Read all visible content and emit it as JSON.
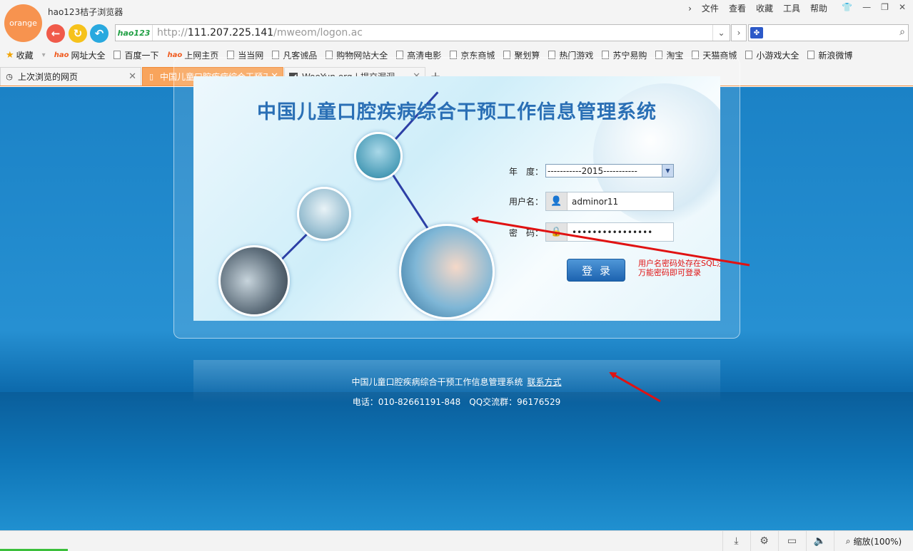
{
  "browser": {
    "logo_text": "orange",
    "title": "hao123桔子浏览器",
    "menu": [
      "文件",
      "查看",
      "收藏",
      "工具",
      "帮助"
    ],
    "address": {
      "badge": "hao123",
      "scheme": "http://",
      "host": "111.207.225.141",
      "path": "/mweom/logon.ac"
    },
    "search_engine_icon": "baidu-paw-icon",
    "bookmarks": [
      "收藏",
      "网址大全",
      "百度一下",
      "上网主页",
      "当当网",
      "凡客诚品",
      "购物网站大全",
      "高清电影",
      "京东商城",
      "聚划算",
      "热门游戏",
      "苏宁易购",
      "淘宝",
      "天猫商城",
      "小游戏大全",
      "新浪微博"
    ],
    "tabs": [
      {
        "label": "上次浏览的网页",
        "active": false
      },
      {
        "label": "中国儿童口腔疾病综合干预工",
        "active": true
      },
      {
        "label": "WooYun.org | 提交漏洞",
        "active": false
      }
    ],
    "accent_color": "#f8a45c"
  },
  "page": {
    "title": "中国儿童口腔疾病综合干预工作信息管理系统",
    "form": {
      "year_label": "年　度：",
      "year_value": "-----------2015-----------",
      "username_label": "用户名：",
      "username_value": "adminor11",
      "password_label": "密　码：",
      "password_value": "••••••••••••••••",
      "login_button": "登录"
    },
    "annotation": "用户名密码处存在SQL注入，使用万能密码即可登录",
    "annotation_color": "#e01212",
    "footer": {
      "system_name": "中国儿童口腔疾病综合干预工作信息管理系统",
      "contact_link": "联系方式",
      "phone": "电话：010-82661191-848　QQ交流群：96176529"
    }
  },
  "statusbar": {
    "zoom": "缩放(100%)"
  }
}
